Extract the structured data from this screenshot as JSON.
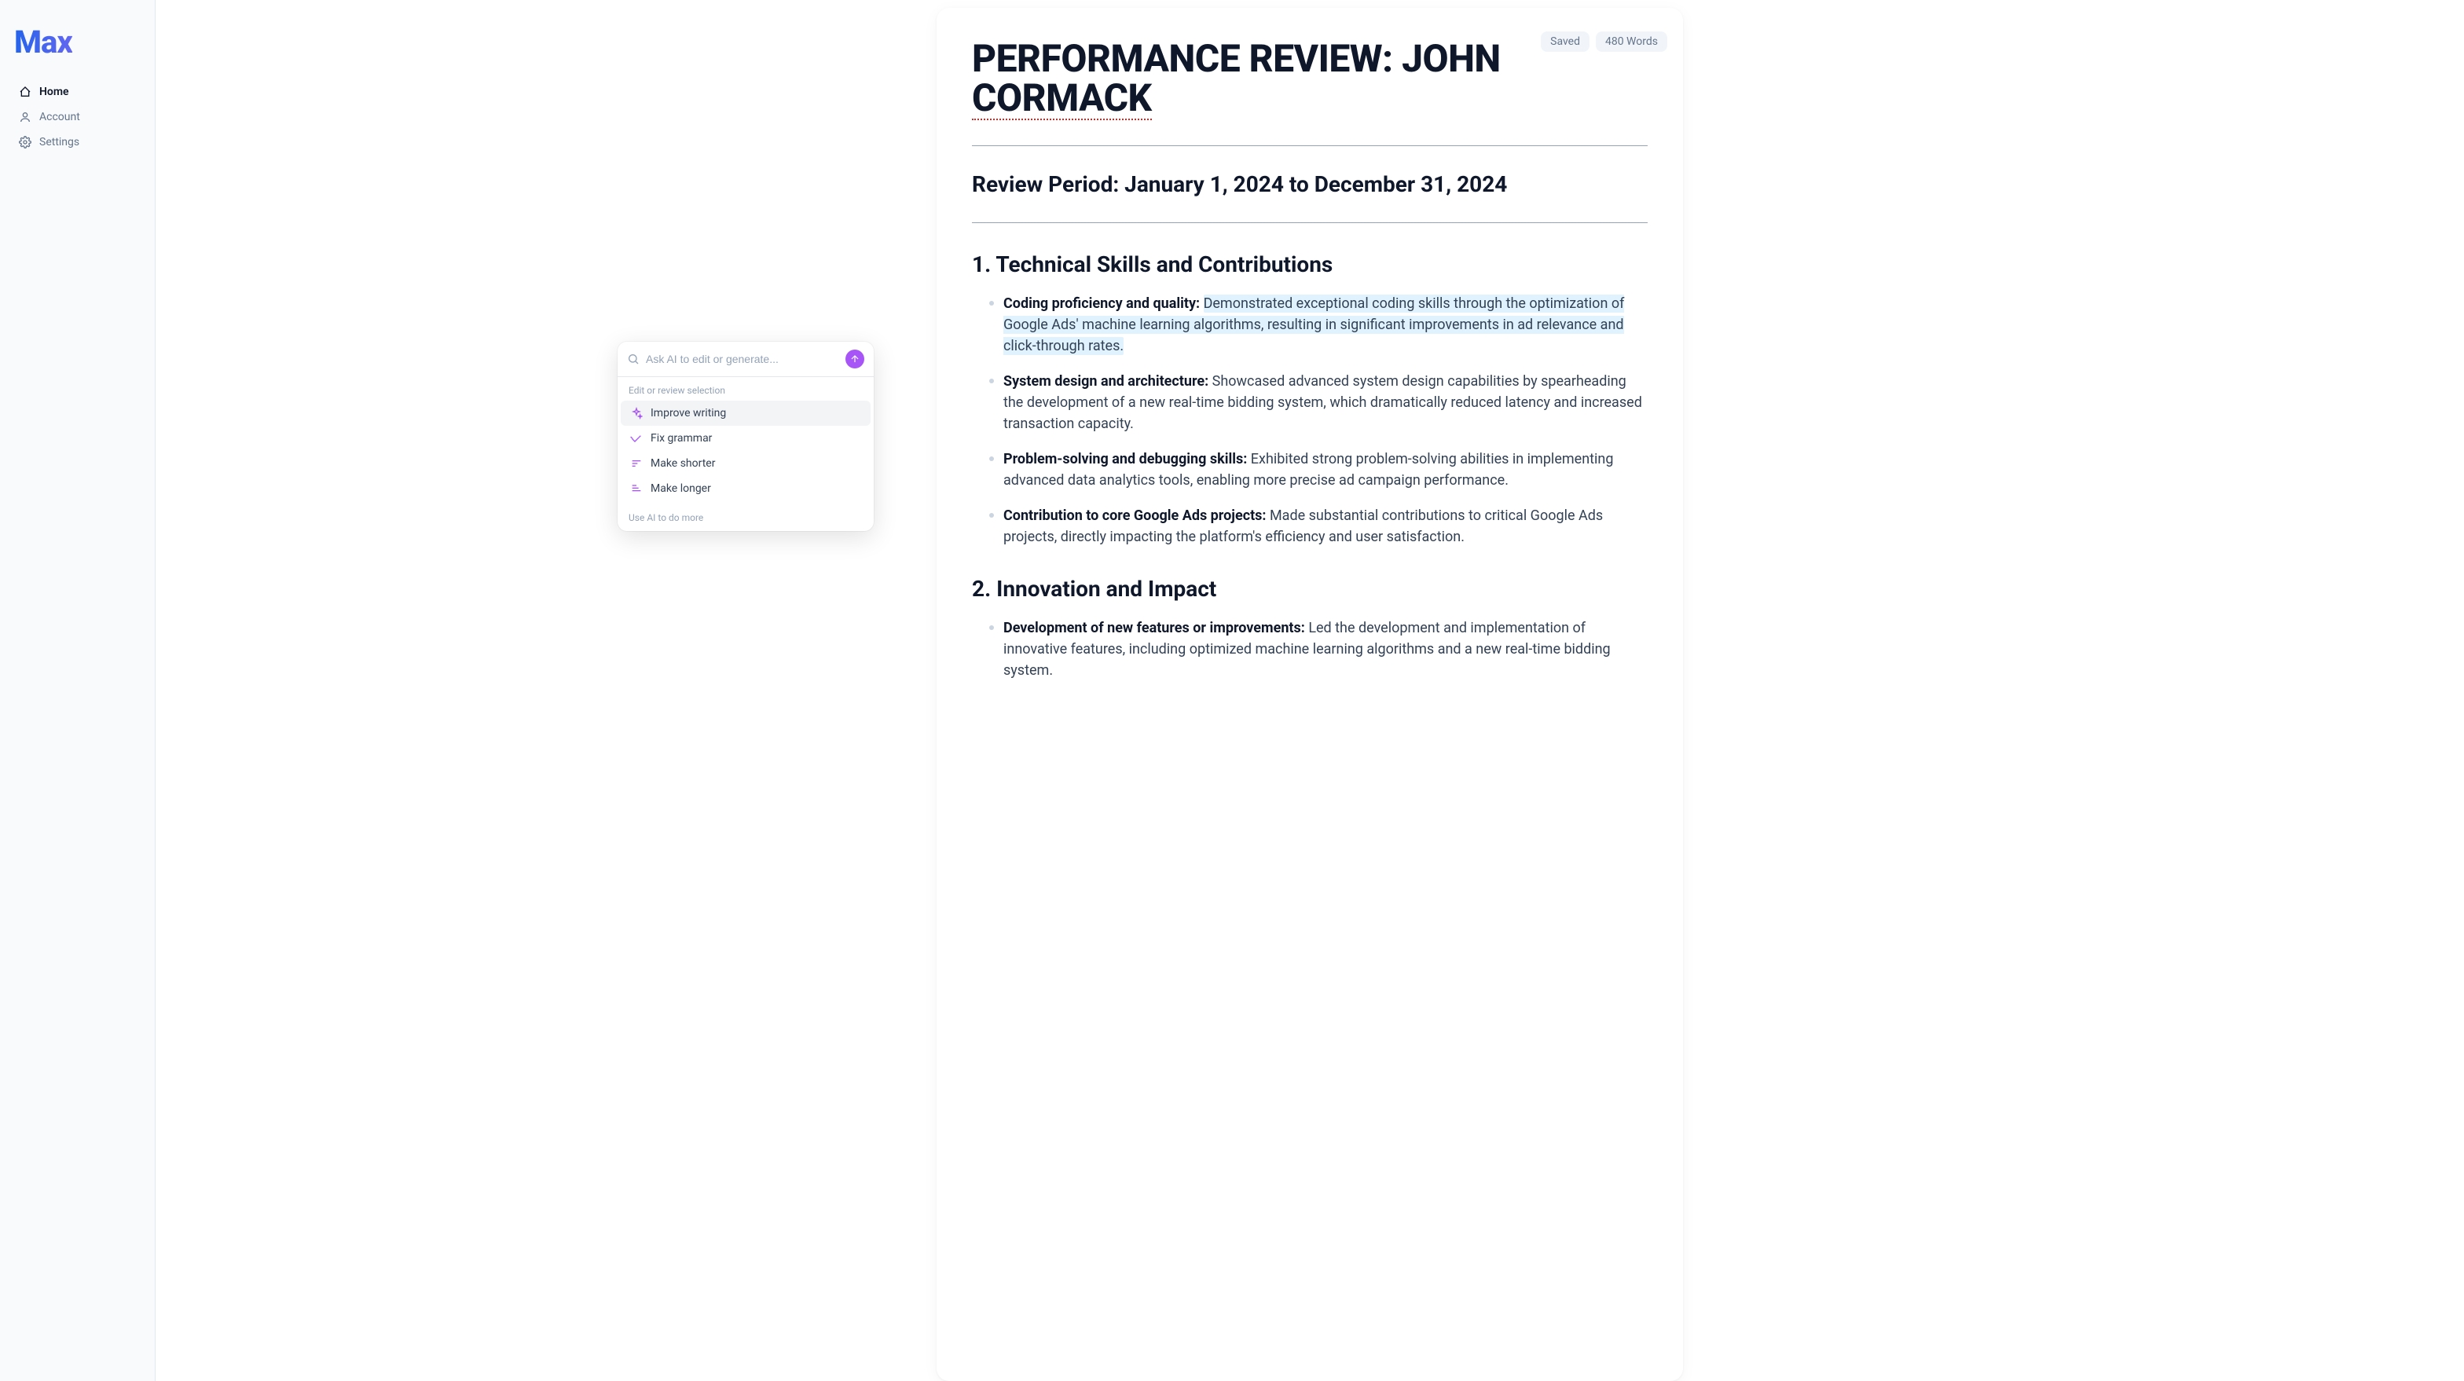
{
  "app": {
    "logo": "Max"
  },
  "sidebar": {
    "items": [
      {
        "label": "Home",
        "icon": "home",
        "active": true
      },
      {
        "label": "Account",
        "icon": "user",
        "active": false
      },
      {
        "label": "Settings",
        "icon": "gear",
        "active": false
      }
    ]
  },
  "badges": {
    "saved": "Saved",
    "words": "480 Words"
  },
  "document": {
    "title_part1": "PERFORMANCE REVIEW: JOHN ",
    "title_part2": "CORMACK",
    "review_period": "Review Period: January 1, 2024 to December 31, 2024",
    "section1": {
      "heading": "1. Technical Skills and Contributions",
      "items": [
        {
          "label": "Coding proficiency and quality: ",
          "text": "Demonstrated exceptional coding skills through the optimization of Google Ads' machine learning algorithms, resulting in significant improvements in ad relevance and click-through rates.",
          "highlighted": true
        },
        {
          "label": "System design and architecture: ",
          "text": "Showcased advanced system design capabilities by spearheading the development of a new real-time bidding system, which dramatically reduced latency and increased transaction capacity."
        },
        {
          "label": "Problem-solving and debugging skills: ",
          "text": "Exhibited strong problem-solving abilities in implementing advanced data analytics tools, enabling more precise ad campaign performance."
        },
        {
          "label": "Contribution to core Google Ads projects: ",
          "text": "Made substantial contributions to critical Google Ads projects, directly impacting the platform's efficiency and user satisfaction."
        }
      ]
    },
    "section2": {
      "heading": "2. Innovation and Impact",
      "items": [
        {
          "label": "Development of new features or improvements: ",
          "text": "Led the development and implementation of innovative features, including optimized machine learning algorithms and a new real-time bidding system."
        }
      ]
    }
  },
  "ai_popup": {
    "placeholder": "Ask AI to edit or generate...",
    "section_label": "Edit or review selection",
    "items": [
      {
        "label": "Improve writing",
        "icon": "sparkle",
        "hovered": true
      },
      {
        "label": "Fix grammar",
        "icon": "check",
        "hovered": false
      },
      {
        "label": "Make shorter",
        "icon": "shorter",
        "hovered": false
      },
      {
        "label": "Make longer",
        "icon": "longer",
        "hovered": false
      }
    ],
    "more_label": "Use AI to do more"
  }
}
